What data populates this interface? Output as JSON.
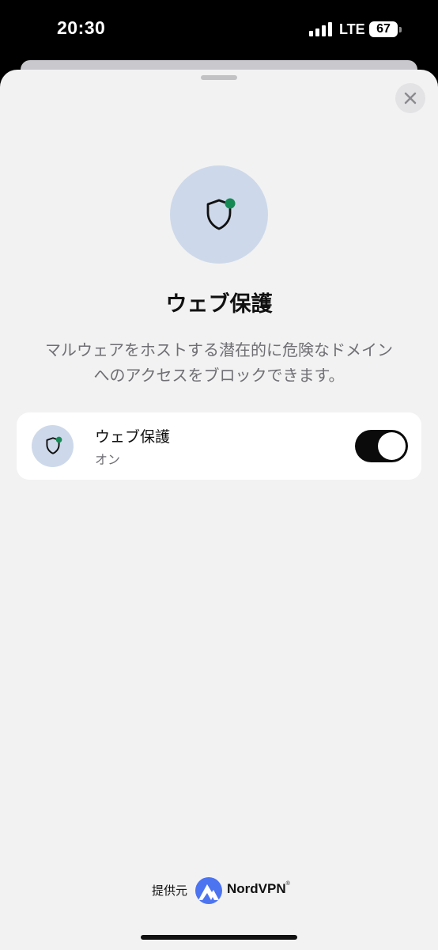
{
  "status_bar": {
    "time": "20:30",
    "network": "LTE",
    "battery": "67"
  },
  "sheet": {
    "title": "ウェブ保護",
    "description_line1": "マルウェアをホストする潜在的に危険なドメイン",
    "description_line2": "へのアクセスをブロックできます。"
  },
  "setting": {
    "label": "ウェブ保護",
    "status": "オン",
    "enabled": true
  },
  "footer": {
    "provided_by": "提供元",
    "brand": "NordVPN",
    "trademark": "®"
  },
  "colors": {
    "accent_dot": "#168a55",
    "icon_bg": "#cdd9ea",
    "toggle_on": "#0b0b0b",
    "brand_blue": "#4c74f0"
  }
}
